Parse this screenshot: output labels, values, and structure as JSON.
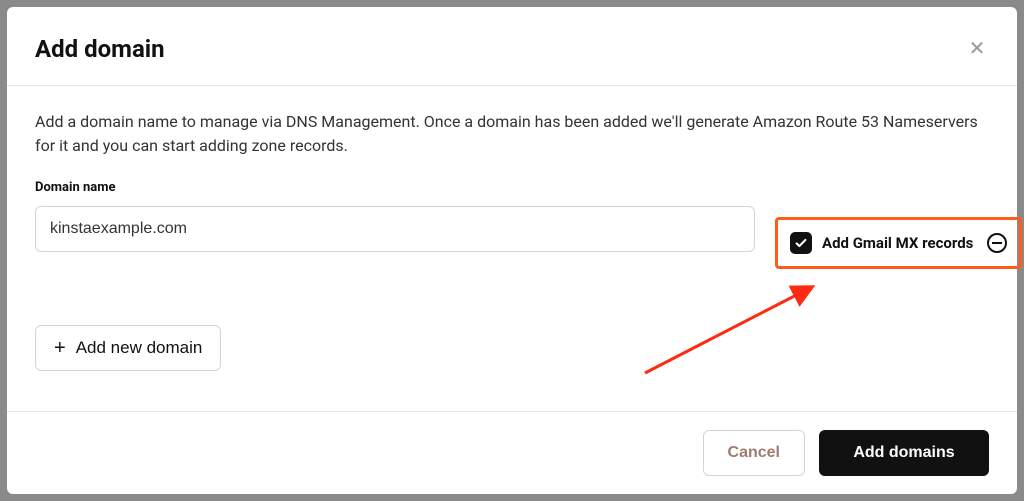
{
  "modal": {
    "title": "Add domain",
    "description": "Add a domain name to manage via DNS Management. Once a domain has been added we'll generate Amazon Route 53 Nameservers for it and you can start adding zone records.",
    "domain_label": "Domain name",
    "domain_value": "kinstaexample.com",
    "gmail_mx_label": "Add Gmail MX records",
    "gmail_mx_checked": true,
    "add_new_label": "Add new domain",
    "cancel_label": "Cancel",
    "submit_label": "Add domains"
  },
  "annotation": {
    "highlight_color": "#ff5b1a",
    "arrow_color": "#ff2a12"
  }
}
